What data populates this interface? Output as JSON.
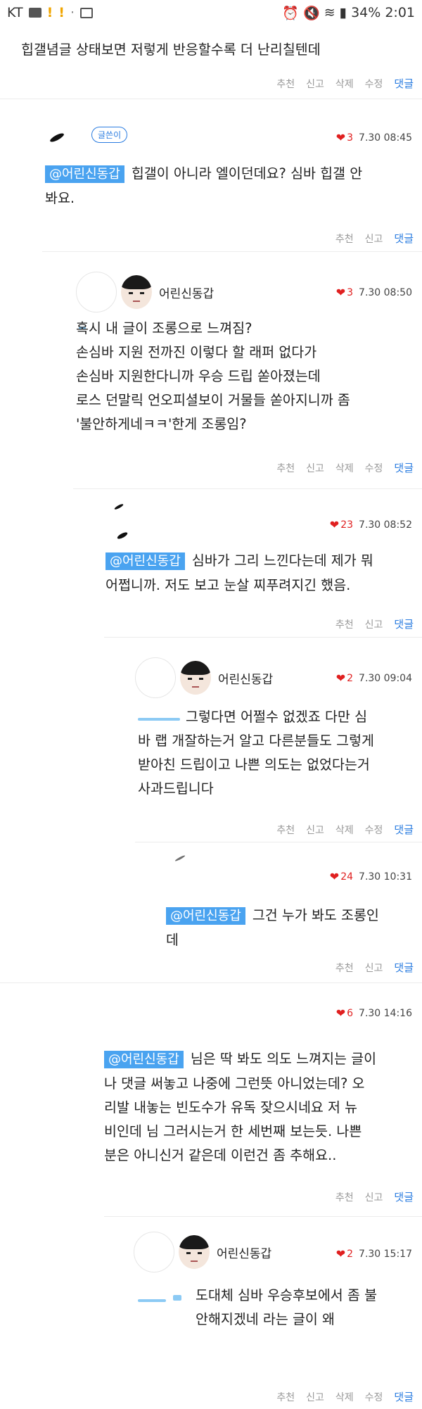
{
  "status_bar": {
    "carrier": "KT",
    "battery": "34%",
    "time": "2:01"
  },
  "post": {
    "text": "힙갤념글 상태보면 저렇게 반응할수록 더 난리칠텐데",
    "actions": {
      "recommend": "추천",
      "report": "신고",
      "delete": "삭제",
      "edit": "수정",
      "reply": "댓글"
    }
  },
  "comments": [
    {
      "badge": "글쓴이",
      "likes": "3",
      "time": "7.30 08:45",
      "mention": "@어린신동갑",
      "text": "힙갤이 아니라 엘이던데요? 심바 힙갤 안\n봐요.",
      "actions": {
        "recommend": "추천",
        "report": "신고",
        "reply": "댓글"
      }
    },
    {
      "nickname": "어린신동갑",
      "likes": "3",
      "time": "7.30 08:50",
      "text": "   혹시 내 글이 조롱으로 느껴짐?\n손심바 지원 전까진 이렇다 할 래퍼 없다가\n손심바 지원한다니까 우승 드립 쏟아졌는데\n로스 던말릭 언오피셜보이 거물들 쏟아지니까 좀\n'불안하게네ㅋㅋ'한게 조롱임?",
      "actions": {
        "recommend": "추천",
        "report": "신고",
        "delete": "삭제",
        "edit": "수정",
        "reply": "댓글"
      }
    },
    {
      "likes": "23",
      "time": "7.30 08:52",
      "mention": "@어린신동갑",
      "text": "심바가 그리 느낀다는데 제가 뭐\n어쩝니까. 저도 보고 눈살 찌푸려지긴 했음.",
      "actions": {
        "recommend": "추천",
        "report": "신고",
        "reply": "댓글"
      }
    },
    {
      "nickname": "어린신동갑",
      "likes": "2",
      "time": "7.30 09:04",
      "text": "그렇다면 어쩔수 없겠죠 다만 심\n바 랩 개잘하는거 알고 다른분들도 그렇게\n받아친 드립이고 나쁜 의도는 없었다는거\n사과드립니다",
      "actions": {
        "recommend": "추천",
        "report": "신고",
        "delete": "삭제",
        "edit": "수정",
        "reply": "댓글"
      }
    },
    {
      "likes": "24",
      "time": "7.30 10:31",
      "mention": "@어린신동갑",
      "text": "그건 누가 봐도 조롱인\n데",
      "actions": {
        "recommend": "추천",
        "report": "신고",
        "reply": "댓글"
      }
    },
    {
      "likes": "6",
      "time": "7.30 14:16",
      "mention": "@어린신동갑",
      "text": "님은 딱 봐도 의도 느껴지는 글이\n나 댓글 써놓고 나중에 그런뜻 아니었는데? 오\n리발 내놓는 빈도수가 유독 잦으시네요 저 뉴\n비인데 님 그러시는거 한 세번째 보는듯. 나쁜\n분은 아니신거 같은데 이런건 좀 추해요..",
      "actions": {
        "recommend": "추천",
        "report": "신고",
        "reply": "댓글"
      }
    },
    {
      "nickname": "어린신동갑",
      "likes": "2",
      "time": "7.30 15:17",
      "text": "도대체 심바 우승후보에서 좀 불\n안해지겠네 라는 글이 왜",
      "actions": {
        "recommend": "추천",
        "report": "신고",
        "delete": "삭제",
        "edit": "수정",
        "reply": "댓글"
      }
    }
  ],
  "icons": {
    "heart": "heart-icon",
    "folder": "folder-icon",
    "alert": "alert-icon",
    "gallery": "image-icon",
    "alarm": "alarm-icon",
    "mute": "mute-icon",
    "wifi": "wifi-icon",
    "signal": "signal-icon"
  },
  "colors": {
    "accent": "#2a7ce0",
    "mention_bg": "#4aa3f0",
    "like": "#e02020"
  }
}
